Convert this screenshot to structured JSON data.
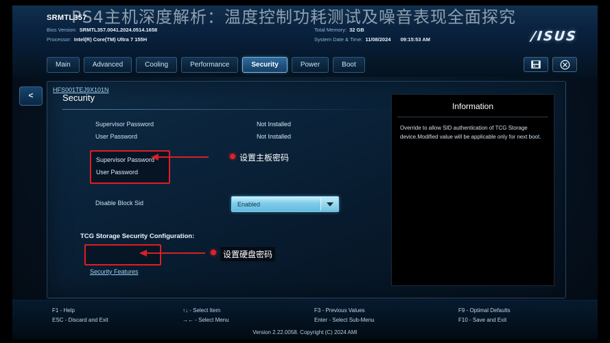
{
  "overlay_title": "PS4主机深度解析：温度控制功耗测试及噪音表现全面探究",
  "header": {
    "model": "SRMTL357",
    "bios_label": "Bios Version:",
    "bios_value": "SRMTL357.0041.2024.0514.1658",
    "processor_label": "Processor:",
    "processor_value": "Intel(R) Core(TM) Ultra 7 155H",
    "memory_label": "Total Memory:",
    "memory_value": "32 GB",
    "datetime_label": "System Date & Time:",
    "date_value": "11/08/2024",
    "time_value": "09:15:53 AM",
    "brand": "/ISUS"
  },
  "tabs": [
    {
      "label": "Main",
      "active": false
    },
    {
      "label": "Advanced",
      "active": false
    },
    {
      "label": "Cooling",
      "active": false
    },
    {
      "label": "Performance",
      "active": false
    },
    {
      "label": "Security",
      "active": true
    },
    {
      "label": "Power",
      "active": false
    },
    {
      "label": "Boot",
      "active": false
    }
  ],
  "collapse_button": "<",
  "page": {
    "title": "Security",
    "rows": [
      {
        "label": "Supervisor Password",
        "value": "Not Installed"
      },
      {
        "label": "User Password",
        "value": "Not Installed"
      }
    ],
    "password_box": {
      "entry1": "Supervisor Password",
      "entry2": "User Password"
    },
    "disable_block_sid": {
      "label": "Disable Block Sid",
      "value": "Enabled"
    },
    "tcg": {
      "title": "TCG Storage Security Configuration:",
      "drive": "HFS001TEJ9X101N"
    },
    "security_features": "Security Features"
  },
  "info": {
    "title": "Information",
    "body": "Override to allow SID authentication of TCG Storage device.Modified value will be applicable only for next boot."
  },
  "annotations": [
    {
      "text": "设置主板密码"
    },
    {
      "text": "设置硬盘密码"
    }
  ],
  "footer": {
    "col1_line1": "F1 - Help",
    "col1_line2": "ESC - Discard and Exit",
    "col2_line1": "↑↓ - Select Item",
    "col2_line2": "→←  - Select Menu",
    "col3_line1": "F3 - Previous Values",
    "col3_line2": "Enter - Select Sub-Menu",
    "col4_line1": "F9 - Optimal Defaults",
    "col4_line2": "F10 - Save and Exit",
    "version": "Version 2.22.0058. Copyright (C) 2024 AMI"
  },
  "colors": {
    "accent_red": "#e11d22",
    "link_blue": "#9fd2f5",
    "active_tab": "#2f6d9e"
  }
}
